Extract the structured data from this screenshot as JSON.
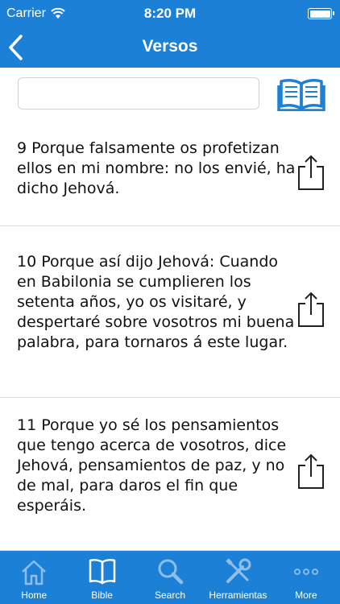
{
  "status_bar": {
    "carrier": "Carrier",
    "time": "8:20 PM"
  },
  "nav": {
    "title": "Versos"
  },
  "search": {
    "value": "",
    "placeholder": ""
  },
  "verses": [
    {
      "text": "9 Porque falsamente os profetizan ellos en mi nombre: no los envié, ha dicho Jehová."
    },
    {
      "text": "10 Porque así dijo Jehová: Cuando en Babilonia se cumplieren los setenta años, yo os visitaré, y despertaré sobre vosotros mi buena palabra, para tornaros á este lugar."
    },
    {
      "text": "11 Porque yo sé los pensamientos que tengo acerca de vosotros, dice Jehová, pensamientos de paz, y no de mal, para daros el fin que esperáis."
    }
  ],
  "tabs": [
    {
      "label": "Home",
      "icon": "home-icon"
    },
    {
      "label": "Bible",
      "icon": "book-icon"
    },
    {
      "label": "Search",
      "icon": "search-icon"
    },
    {
      "label": "Herramientas",
      "icon": "tools-icon"
    },
    {
      "label": "More",
      "icon": "more-icon"
    }
  ],
  "colors": {
    "accent": "#1c80d6",
    "tab_active": "#ffffff",
    "tab_inactive": "#8fbfe9"
  }
}
